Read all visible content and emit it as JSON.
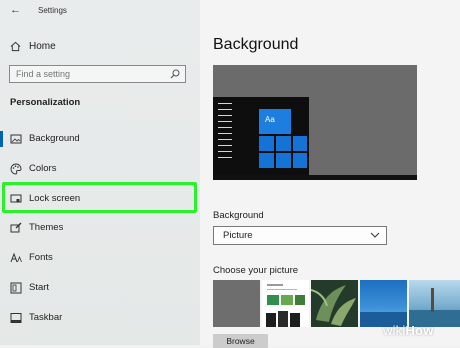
{
  "window": {
    "title": "Settings",
    "back_glyph": "←"
  },
  "sidebar": {
    "home_label": "Home",
    "search_placeholder": "Find a setting",
    "section_title": "Personalization",
    "items": [
      {
        "label": "Background",
        "icon": "picture-icon",
        "selected": true
      },
      {
        "label": "Colors",
        "icon": "palette-icon"
      },
      {
        "label": "Lock screen",
        "icon": "lock-screen-icon",
        "highlighted": true
      },
      {
        "label": "Themes",
        "icon": "brush-icon"
      },
      {
        "label": "Fonts",
        "icon": "font-icon"
      },
      {
        "label": "Start",
        "icon": "start-icon"
      },
      {
        "label": "Taskbar",
        "icon": "taskbar-icon"
      }
    ]
  },
  "main": {
    "title": "Background",
    "preview": {
      "tile_text": "Aa"
    },
    "background_label": "Background",
    "background_select": {
      "value": "Picture"
    },
    "choose_label": "Choose your picture",
    "browse_label": "Browse"
  },
  "watermark": {
    "prefix": "wiki",
    "suffix": "How"
  },
  "colors": {
    "accent": "#0063b1",
    "highlight": "#2bf12b",
    "tile": "#1473d4"
  }
}
